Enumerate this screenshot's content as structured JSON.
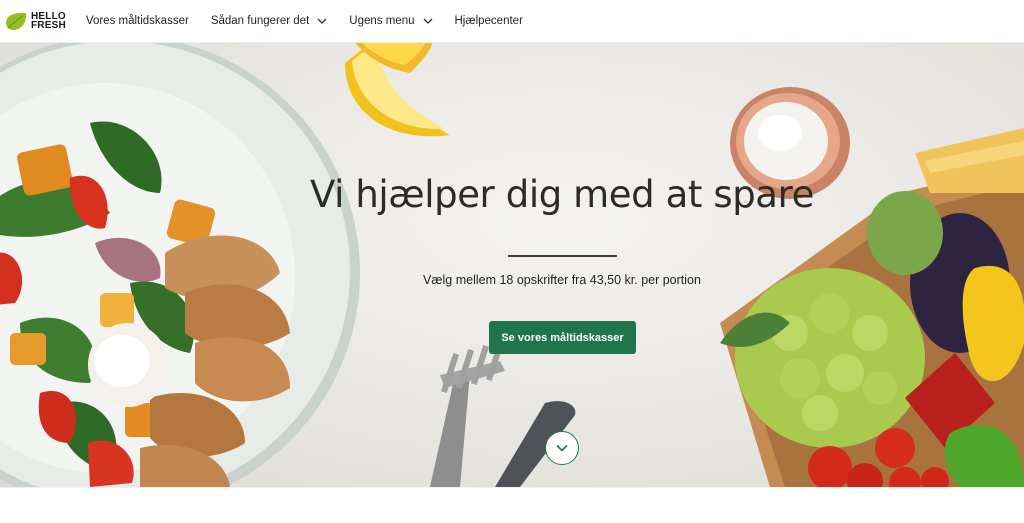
{
  "brand": {
    "line1": "HELLO",
    "line2": "FRESH",
    "leaf_color": "#91c11e"
  },
  "nav": {
    "items": [
      {
        "label": "Vores måltidskasser",
        "has_dropdown": false
      },
      {
        "label": "Sådan fungerer det",
        "has_dropdown": true
      },
      {
        "label": "Ugens menu",
        "has_dropdown": true
      },
      {
        "label": "Hjælpecenter",
        "has_dropdown": false
      }
    ]
  },
  "hero": {
    "title": "Vi hjælper dig med at spare",
    "subtitle": "Vælg mellem 18 opskrifter fra 43,50 kr. per portion",
    "cta_label": "Se vores måltidskasser",
    "scroll_icon": "chevron-down-icon"
  },
  "colors": {
    "accent": "#20764a",
    "title": "#2d2b26"
  }
}
